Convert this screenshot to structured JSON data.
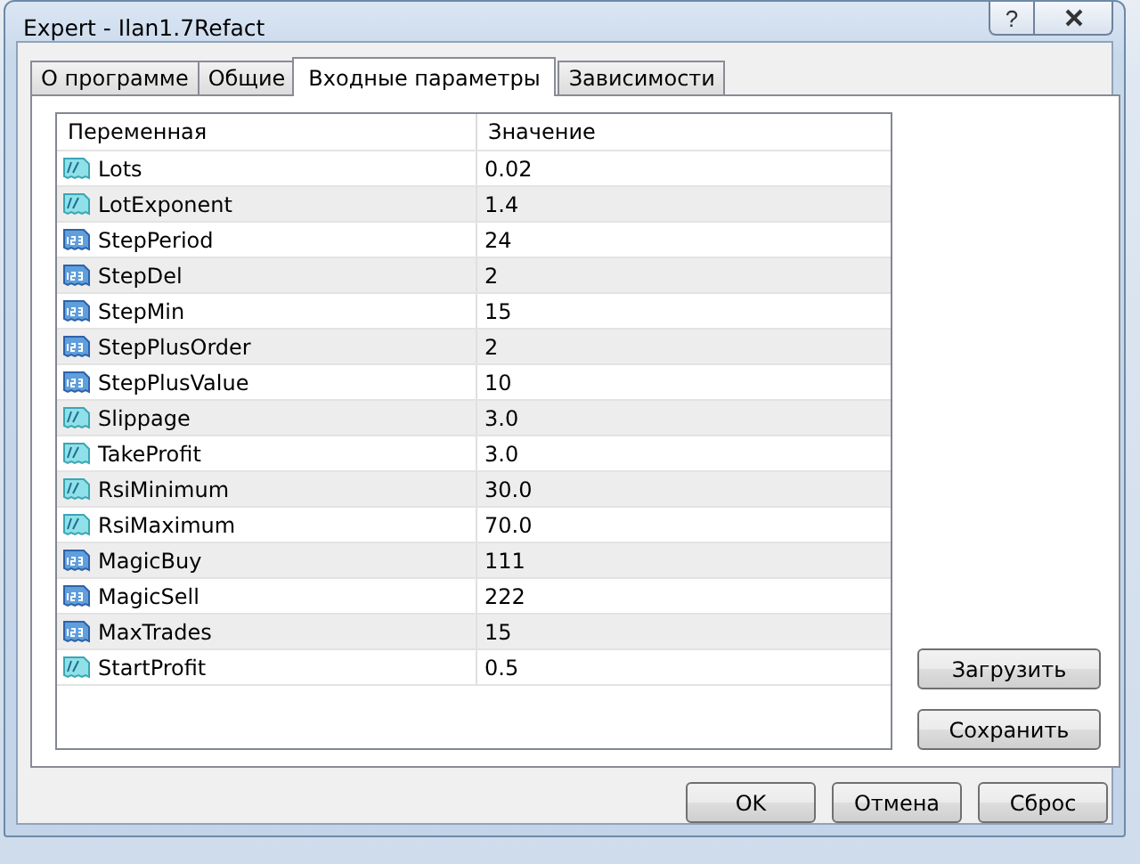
{
  "window": {
    "title": "Expert - Ilan1.7Refact",
    "help_button": "?"
  },
  "tabs": [
    {
      "label": "О программе",
      "selected": false
    },
    {
      "label": "Общие",
      "selected": false
    },
    {
      "label": "Входные параметры",
      "selected": true
    },
    {
      "label": "Зависимости",
      "selected": false
    }
  ],
  "table": {
    "columns": [
      "Переменная",
      "Значение"
    ],
    "rows": [
      {
        "kind": "double",
        "name": "Lots",
        "value": "0.02"
      },
      {
        "kind": "double",
        "name": "LotExponent",
        "value": "1.4"
      },
      {
        "kind": "int",
        "name": "StepPeriod",
        "value": "24"
      },
      {
        "kind": "int",
        "name": "StepDel",
        "value": "2"
      },
      {
        "kind": "int",
        "name": "StepMin",
        "value": "15"
      },
      {
        "kind": "int",
        "name": "StepPlusOrder",
        "value": "2"
      },
      {
        "kind": "int",
        "name": "StepPlusValue",
        "value": "10"
      },
      {
        "kind": "double",
        "name": "Slippage",
        "value": "3.0"
      },
      {
        "kind": "double",
        "name": "TakeProfit",
        "value": "3.0"
      },
      {
        "kind": "double",
        "name": "RsiMinimum",
        "value": "30.0"
      },
      {
        "kind": "double",
        "name": "RsiMaximum",
        "value": "70.0"
      },
      {
        "kind": "int",
        "name": "MagicBuy",
        "value": "111"
      },
      {
        "kind": "int",
        "name": "MagicSell",
        "value": "222"
      },
      {
        "kind": "int",
        "name": "MaxTrades",
        "value": "15"
      },
      {
        "kind": "double",
        "name": "StartProfit",
        "value": "0.5"
      }
    ]
  },
  "side_buttons": [
    "Загрузить",
    "Сохранить"
  ],
  "buttons": [
    "OK",
    "Отмена",
    "Сброс"
  ]
}
